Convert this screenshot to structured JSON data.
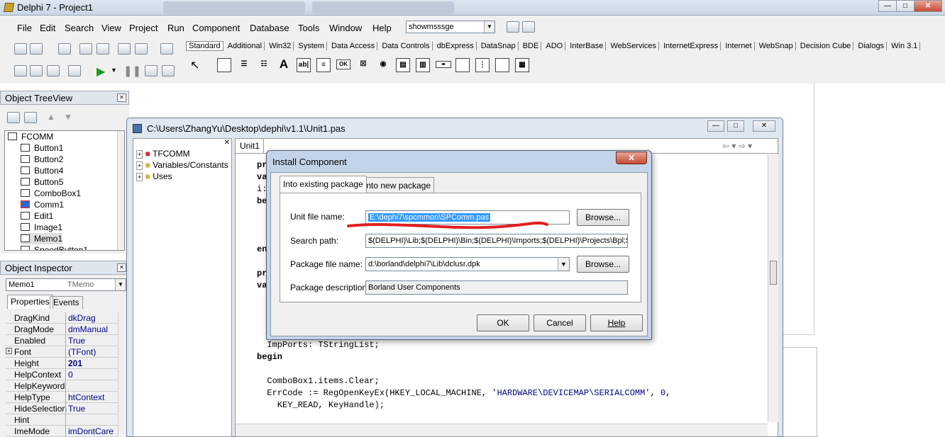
{
  "app": {
    "title": "Delphi 7 - Project1"
  },
  "menu": {
    "items": [
      "File",
      "Edit",
      "Search",
      "View",
      "Project",
      "Run",
      "Component",
      "Database",
      "Tools",
      "Window",
      "Help"
    ],
    "combo_value": "showmsssge"
  },
  "palette": {
    "tabs": [
      "Standard",
      "Additional",
      "Win32",
      "System",
      "Data Access",
      "Data Controls",
      "dbExpress",
      "DataSnap",
      "BDE",
      "ADO",
      "InterBase",
      "WebServices",
      "InternetExpress",
      "Internet",
      "WebSnap",
      "Decision Cube",
      "Dialogs",
      "Win 3.1"
    ]
  },
  "treeview": {
    "title": "Object TreeView",
    "root": "FCOMM",
    "items": [
      "Button1",
      "Button2",
      "Button4",
      "Button5",
      "ComboBox1",
      "Comm1",
      "Edit1",
      "Image1",
      "Memo1",
      "SpeedButton1"
    ]
  },
  "inspector": {
    "title": "Object Inspector",
    "object": "Memo1",
    "object_type": "TMemo",
    "tabs": [
      "Properties",
      "Events"
    ],
    "rows": [
      {
        "k": "DragKind",
        "v": "dkDrag"
      },
      {
        "k": "DragMode",
        "v": "dmManual"
      },
      {
        "k": "Enabled",
        "v": "True"
      },
      {
        "k": "Font",
        "v": "(TFont)"
      },
      {
        "k": "Height",
        "v": "201"
      },
      {
        "k": "HelpContext",
        "v": "0"
      },
      {
        "k": "HelpKeyword",
        "v": ""
      },
      {
        "k": "HelpType",
        "v": "htContext"
      },
      {
        "k": "HideSelection",
        "v": "True"
      },
      {
        "k": "Hint",
        "v": ""
      },
      {
        "k": "ImeMode",
        "v": "imDontCare"
      }
    ]
  },
  "codewin": {
    "title": "C:\\Users\\ZhangYu\\Desktop\\dephi\\v1.1\\Unit1.pas",
    "tab": "Unit1",
    "explorer": [
      "TFCOMM",
      "Variables/Constants",
      "Uses"
    ]
  },
  "code": {
    "l1": "pr",
    "l2": "va",
    "l3": "i:",
    "l4": "be",
    "l5": "en",
    "l6": "pr",
    "l7": "va",
    "l8": "  ImpPorts: TStringList;",
    "l9": "begin",
    "l10": "  ComboBox1.items.Clear;",
    "l11a": "  ErrCode := RegOpenKeyEx(HKEY_LOCAL_MACHINE, ",
    "l11b": "'HARDWARE\\DEVICEMAP\\SERIALCOMM'",
    "l11c": ", ",
    "l11d": "0",
    "l11e": ",",
    "l12": "    KEY_READ, KeyHandle);"
  },
  "dialog": {
    "title": "Install Component",
    "tab_existing": "Into existing package",
    "tab_new": "Into new package",
    "unit_label": "Unit file name:",
    "unit_value": "E:\\dephi7\\spcmmon\\SPComm.pas",
    "search_label": "Search path:",
    "search_value": "$(DELPHI)\\Lib;$(DELPHI)\\Bin;$(DELPHI)\\Imports;$(DELPHI)\\Projects\\Bpl;$",
    "package_label": "Package file name:",
    "package_value": "d:\\borland\\delphi7\\Lib\\dclusr.dpk",
    "desc_label": "Package description:",
    "desc_value": "Borland User Components",
    "browse": "Browse...",
    "ok": "OK",
    "cancel": "Cancel",
    "help": "Help"
  },
  "colors": {
    "selection": "#3399ff",
    "annotation_red": "#e02020"
  }
}
